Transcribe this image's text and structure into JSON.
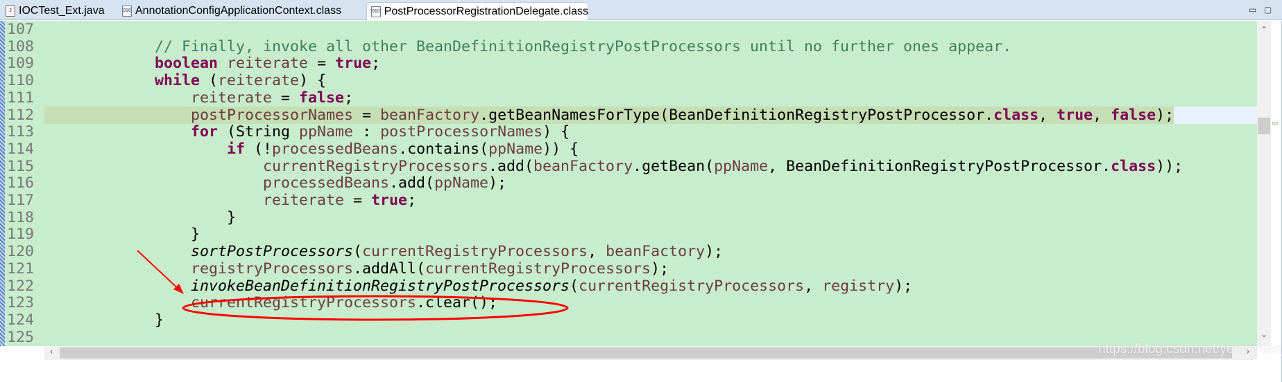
{
  "tabs": [
    {
      "label": "IOCTest_Ext.java",
      "icon": "java-file-icon",
      "active": false
    },
    {
      "label": "AnnotationConfigApplicationContext.class",
      "icon": "class-file-icon",
      "active": false
    },
    {
      "label": "PostProcessorRegistrationDelegate.class",
      "icon": "class-file-icon",
      "active": true
    }
  ],
  "window_buttons": {
    "minimize": "▭",
    "maximize": "▢"
  },
  "editor": {
    "current_line": 112,
    "lines": [
      {
        "n": "107",
        "t": []
      },
      {
        "n": "108",
        "t": [
          [
            "pl",
            "            "
          ],
          [
            "cm",
            "// Finally, invoke all other BeanDefinitionRegistryPostProcessors until no further ones appear."
          ]
        ]
      },
      {
        "n": "109",
        "t": [
          [
            "pl",
            "            "
          ],
          [
            "kw",
            "boolean"
          ],
          [
            "pl",
            " "
          ],
          [
            "lv",
            "reiterate"
          ],
          [
            "pl",
            " = "
          ],
          [
            "kw",
            "true"
          ],
          [
            "pl",
            ";"
          ]
        ]
      },
      {
        "n": "110",
        "t": [
          [
            "pl",
            "            "
          ],
          [
            "kw",
            "while"
          ],
          [
            "pl",
            " ("
          ],
          [
            "lv",
            "reiterate"
          ],
          [
            "pl",
            ") {"
          ]
        ]
      },
      {
        "n": "111",
        "t": [
          [
            "pl",
            "                "
          ],
          [
            "lv",
            "reiterate"
          ],
          [
            "pl",
            " = "
          ],
          [
            "kw",
            "false"
          ],
          [
            "pl",
            ";"
          ]
        ]
      },
      {
        "n": "112",
        "t": [
          [
            "pl",
            "                "
          ],
          [
            "lv",
            "postProcessorNames"
          ],
          [
            "pl",
            " = "
          ],
          [
            "lv",
            "beanFactory"
          ],
          [
            "pl",
            ".getBeanNamesForType(BeanDefinitionRegistryPostProcessor."
          ],
          [
            "kw",
            "class"
          ],
          [
            "pl",
            ", "
          ],
          [
            "kw",
            "true"
          ],
          [
            "pl",
            ", "
          ],
          [
            "kw",
            "false"
          ],
          [
            "pl",
            ");"
          ]
        ]
      },
      {
        "n": "113",
        "t": [
          [
            "pl",
            "                "
          ],
          [
            "kw",
            "for"
          ],
          [
            "pl",
            " (String "
          ],
          [
            "lv",
            "ppName"
          ],
          [
            "pl",
            " : "
          ],
          [
            "lv",
            "postProcessorNames"
          ],
          [
            "pl",
            ") {"
          ]
        ]
      },
      {
        "n": "114",
        "t": [
          [
            "pl",
            "                    "
          ],
          [
            "kw",
            "if"
          ],
          [
            "pl",
            " (!"
          ],
          [
            "lv",
            "processedBeans"
          ],
          [
            "pl",
            ".contains("
          ],
          [
            "lv",
            "ppName"
          ],
          [
            "pl",
            ")) {"
          ]
        ]
      },
      {
        "n": "115",
        "t": [
          [
            "pl",
            "                        "
          ],
          [
            "lv",
            "currentRegistryProcessors"
          ],
          [
            "pl",
            ".add("
          ],
          [
            "lv",
            "beanFactory"
          ],
          [
            "pl",
            ".getBean("
          ],
          [
            "lv",
            "ppName"
          ],
          [
            "pl",
            ", BeanDefinitionRegistryPostProcessor."
          ],
          [
            "kw",
            "class"
          ],
          [
            "pl",
            "));"
          ]
        ]
      },
      {
        "n": "116",
        "t": [
          [
            "pl",
            "                        "
          ],
          [
            "lv",
            "processedBeans"
          ],
          [
            "pl",
            ".add("
          ],
          [
            "lv",
            "ppName"
          ],
          [
            "pl",
            ");"
          ]
        ]
      },
      {
        "n": "117",
        "t": [
          [
            "pl",
            "                        "
          ],
          [
            "lv",
            "reiterate"
          ],
          [
            "pl",
            " = "
          ],
          [
            "kw",
            "true"
          ],
          [
            "pl",
            ";"
          ]
        ]
      },
      {
        "n": "118",
        "t": [
          [
            "pl",
            "                    }"
          ]
        ]
      },
      {
        "n": "119",
        "t": [
          [
            "pl",
            "                }"
          ]
        ]
      },
      {
        "n": "120",
        "t": [
          [
            "pl",
            "                "
          ],
          [
            "st",
            "sortPostProcessors"
          ],
          [
            "pl",
            "("
          ],
          [
            "lv",
            "currentRegistryProcessors"
          ],
          [
            "pl",
            ", "
          ],
          [
            "lv",
            "beanFactory"
          ],
          [
            "pl",
            ");"
          ]
        ]
      },
      {
        "n": "121",
        "t": [
          [
            "pl",
            "                "
          ],
          [
            "lv",
            "registryProcessors"
          ],
          [
            "pl",
            ".addAll("
          ],
          [
            "lv",
            "currentRegistryProcessors"
          ],
          [
            "pl",
            ");"
          ]
        ]
      },
      {
        "n": "122",
        "t": [
          [
            "pl",
            "                "
          ],
          [
            "st",
            "invokeBeanDefinitionRegistryPostProcessors"
          ],
          [
            "pl",
            "("
          ],
          [
            "lv",
            "currentRegistryProcessors"
          ],
          [
            "pl",
            ", "
          ],
          [
            "lv",
            "registry"
          ],
          [
            "pl",
            ");"
          ]
        ]
      },
      {
        "n": "123",
        "t": [
          [
            "pl",
            "                "
          ],
          [
            "lv",
            "currentRegistryProcessors"
          ],
          [
            "pl",
            ".clear();"
          ]
        ]
      },
      {
        "n": "124",
        "t": [
          [
            "pl",
            "            }"
          ]
        ]
      },
      {
        "n": "125",
        "t": []
      }
    ]
  },
  "scroll": {
    "left_arrow": "‹",
    "right_arrow": "›",
    "up_arrow": "⌃",
    "down_arrow": "⌄"
  },
  "annotation_color": "#ff0000",
  "watermark": "https://blog.csdn.net/yerenyuan_pku"
}
